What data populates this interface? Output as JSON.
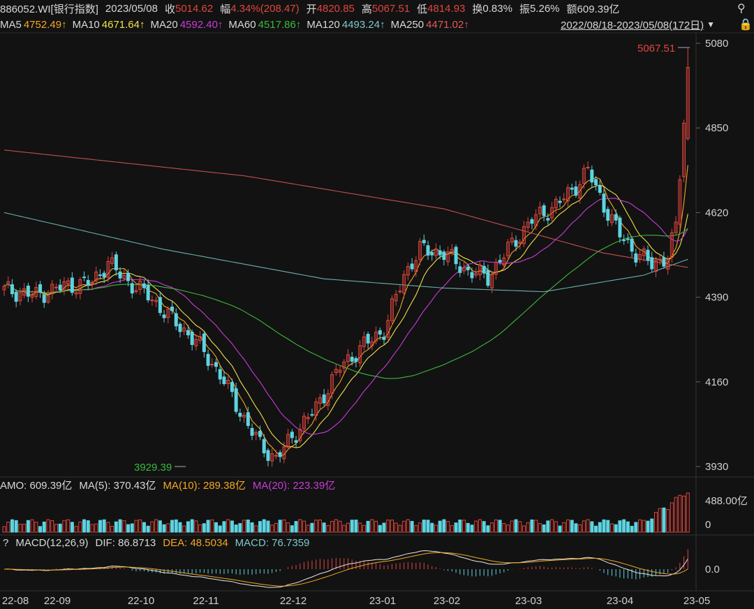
{
  "header": {
    "code": "886052.WI[银行指数]",
    "date": "2023/05/08",
    "close_label": "收",
    "close": "5014.62",
    "change_label": "幅",
    "change": "4.34%(208.47)",
    "open_label": "开",
    "open": "4820.85",
    "high_label": "高",
    "high": "5067.51",
    "low_label": "低",
    "low": "4814.93",
    "turnover_label": "换",
    "turnover": "0.83%",
    "amplitude_label": "振",
    "amplitude": "5.26%",
    "amount_label": "额",
    "amount": "609.39亿"
  },
  "ma": [
    {
      "label": "MA5",
      "value": "4752.49",
      "arrow": "↑",
      "color": "#f5a623"
    },
    {
      "label": "MA10",
      "value": "4671.64",
      "arrow": "↑",
      "color": "#f0e04a"
    },
    {
      "label": "MA20",
      "value": "4592.40",
      "arrow": "↑",
      "color": "#c83cd8"
    },
    {
      "label": "MA60",
      "value": "4517.86",
      "arrow": "↑",
      "color": "#3cb83c"
    },
    {
      "label": "MA120",
      "value": "4493.24",
      "arrow": "↑",
      "color": "#7ec8c8"
    },
    {
      "label": "MA250",
      "value": "4471.02",
      "arrow": "↑",
      "color": "#e05a5a"
    }
  ],
  "range": {
    "text": "2022/08/18-2023/05/08(172日)",
    "dropdown": "▼"
  },
  "icons": {
    "search": "search-icon",
    "lock": "lock-icon"
  },
  "price_axis": {
    "ticks": [
      "5080",
      "4850",
      "4620",
      "4390",
      "4160",
      "3930"
    ],
    "tick_values": [
      5080,
      4850,
      4620,
      4390,
      4160,
      3930
    ]
  },
  "annotations": {
    "max_label": "5067.51",
    "min_label": "3929.39"
  },
  "volume_header": {
    "amo_label": "AMO: 609.39亿",
    "ma5_label": "MA(5): 370.43亿",
    "ma10_label": "MA(10): 289.38亿",
    "ma20_label": "MA(20): 223.39亿",
    "ma10_color": "#f5a623",
    "ma20_color": "#c83cd8"
  },
  "volume_axis": {
    "top": "488.00亿",
    "zero": "0"
  },
  "macd_header": {
    "help": "?",
    "title": "MACD(12,26,9)",
    "dif": "DIF: 86.8713",
    "dea": "DEA: 48.5034",
    "macd": "MACD: 76.7359",
    "dea_color": "#f5a623",
    "macd_color": "#7ec8c8"
  },
  "macd_axis": {
    "zero": "0.0"
  },
  "date_axis": [
    "22-08",
    "22-09",
    "22-10",
    "22-11",
    "22-12",
    "23-01",
    "23-02",
    "23-03",
    "23-04",
    "23-05"
  ],
  "colors": {
    "up": "#e0463e",
    "down": "#5fd3e0",
    "bg": "#121212",
    "grid": "#2a2a2a"
  }
}
